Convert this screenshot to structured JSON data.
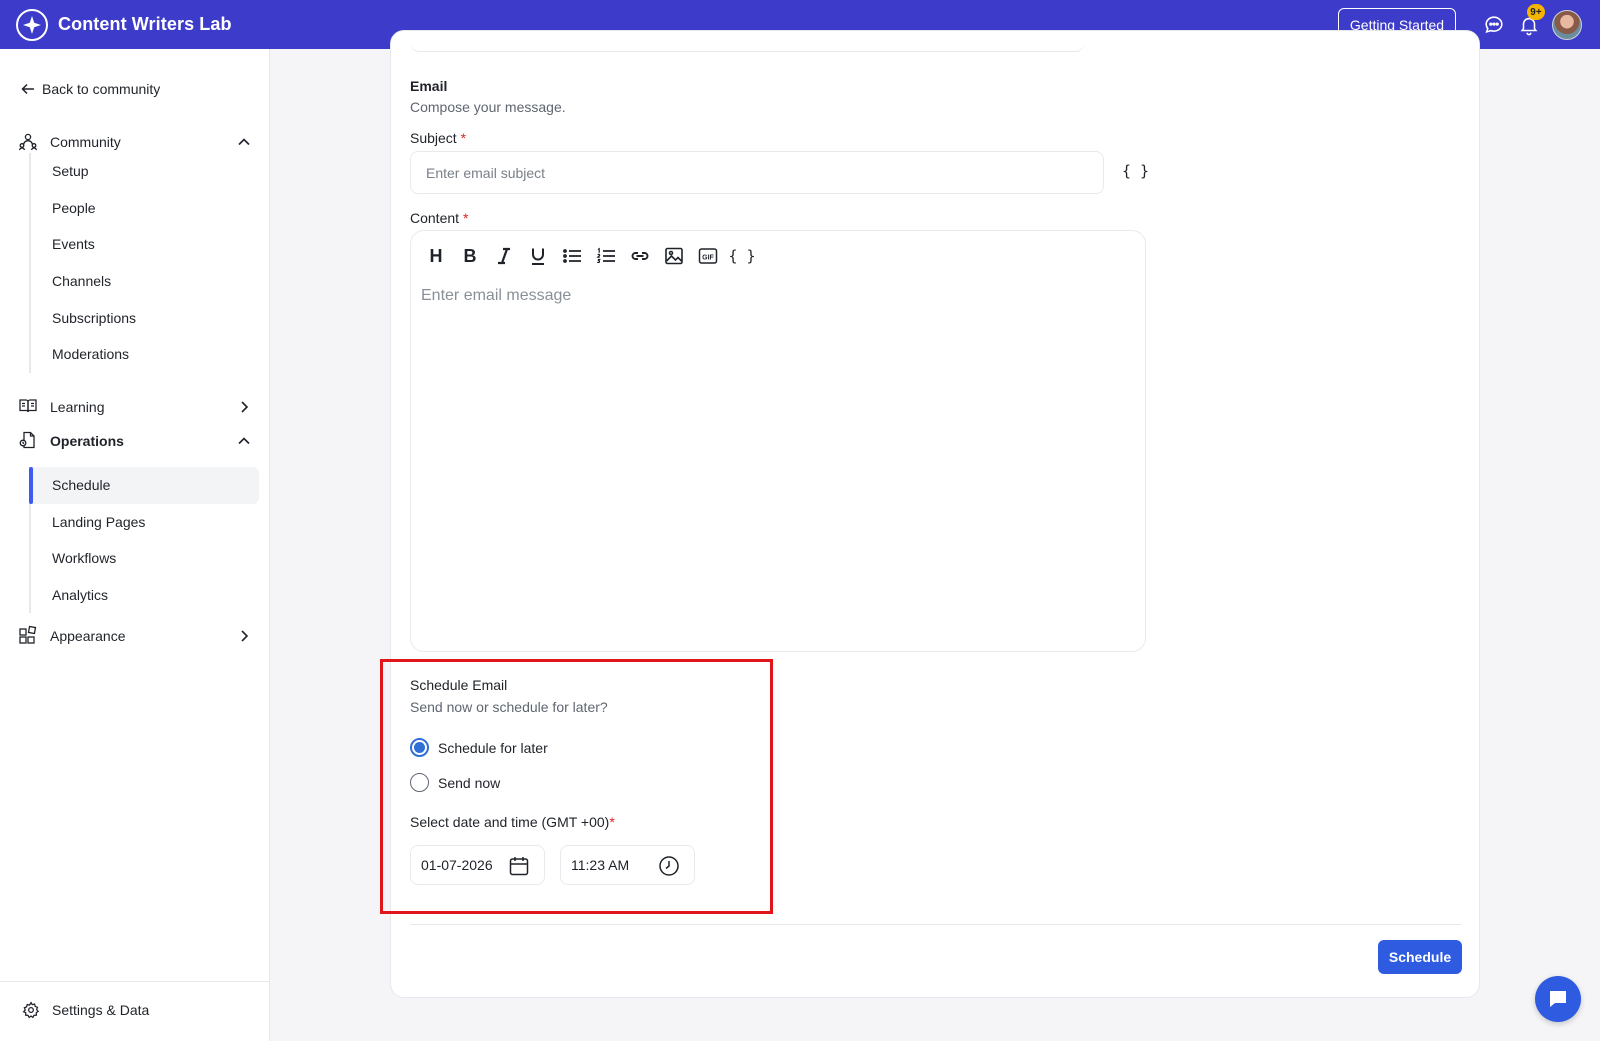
{
  "header": {
    "app_title": "Content Writers Lab",
    "getting_started_label": "Getting Started",
    "notifications_badge": "9+",
    "brand_color": "#3d3bc9"
  },
  "sidebar": {
    "back_label": "Back to community",
    "sections": {
      "community": {
        "label": "Community",
        "expanded": true,
        "items": [
          "Setup",
          "People",
          "Events",
          "Channels",
          "Subscriptions",
          "Moderations"
        ]
      },
      "learning": {
        "label": "Learning",
        "expanded": false
      },
      "operations": {
        "label": "Operations",
        "expanded": true,
        "items": [
          "Schedule",
          "Landing Pages",
          "Workflows",
          "Analytics"
        ],
        "active_item": "Schedule"
      },
      "appearance": {
        "label": "Appearance",
        "expanded": false
      }
    },
    "settings_label": "Settings & Data"
  },
  "email": {
    "title": "Email",
    "subtitle": "Compose your message.",
    "subject_label": "Subject",
    "subject_required_mark": "*",
    "subject_placeholder": "Enter email subject",
    "subject_value": "",
    "variables_glyph": "{ }",
    "content_label": "Content",
    "content_required_mark": "*",
    "content_placeholder": "Enter email message",
    "content_value": "",
    "toolbar": [
      "heading-icon",
      "bold-icon",
      "italic-icon",
      "underline-icon",
      "bullet-list-icon",
      "numbered-list-icon",
      "link-icon",
      "image-icon",
      "gif-icon",
      "variables-icon"
    ],
    "toolbar_labels": {
      "heading": "H",
      "bold": "B",
      "gif": "GIF"
    }
  },
  "schedule": {
    "title": "Schedule Email",
    "subtitle": "Send now or schedule for later?",
    "options": [
      {
        "label": "Schedule for later",
        "selected": true
      },
      {
        "label": "Send now",
        "selected": false
      }
    ],
    "datetime_label": "Select date and time (GMT +00)",
    "datetime_required_mark": "*",
    "date_value": "01-07-2026",
    "time_value": "11:23 AM",
    "submit_label": "Schedule",
    "accent_color": "#2f5be0",
    "highlight_color": "#e0161b"
  }
}
